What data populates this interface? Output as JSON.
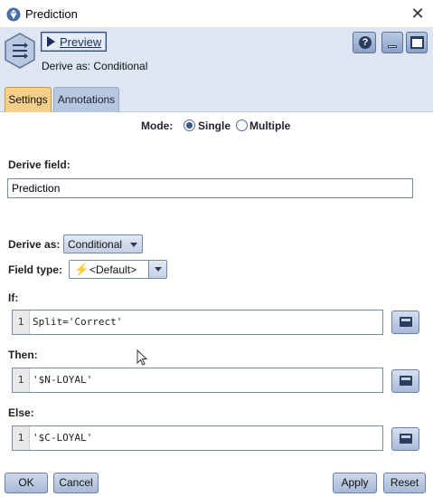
{
  "window": {
    "title": "Prediction",
    "close_glyph": "✕"
  },
  "header": {
    "preview_label": "Preview",
    "derive_summary": "Derive as: Conditional",
    "help_glyph": "?"
  },
  "tabs": [
    {
      "label": "Settings",
      "active": true
    },
    {
      "label": "Annotations",
      "active": false
    }
  ],
  "settings": {
    "mode_label": "Mode:",
    "mode_options": [
      "Single",
      "Multiple"
    ],
    "mode_selected": "Single",
    "derive_field_label": "Derive field:",
    "derive_field_value": "Prediction",
    "derive_as_label": "Derive as:",
    "derive_as_value": "Conditional",
    "field_type_label": "Field type:",
    "field_type_value": "<Default>",
    "if_label": "If:",
    "if_line": "1",
    "if_expr": "Split='Correct'",
    "then_label": "Then:",
    "then_line": "1",
    "then_expr": "'$N-LOYAL'",
    "else_label": "Else:",
    "else_line": "1",
    "else_expr": "'$C-LOYAL'"
  },
  "footer": {
    "ok": "OK",
    "cancel": "Cancel",
    "apply": "Apply",
    "reset": "Reset"
  },
  "icons": {
    "title": "gem-icon",
    "node": "derive-node-icon",
    "field_type": "lightning-icon",
    "expression_builder": "calculator-icon"
  },
  "colors": {
    "header_bg": "#dde6f2",
    "active_tab": "#f6d088",
    "button_border": "#2e4a7a"
  }
}
